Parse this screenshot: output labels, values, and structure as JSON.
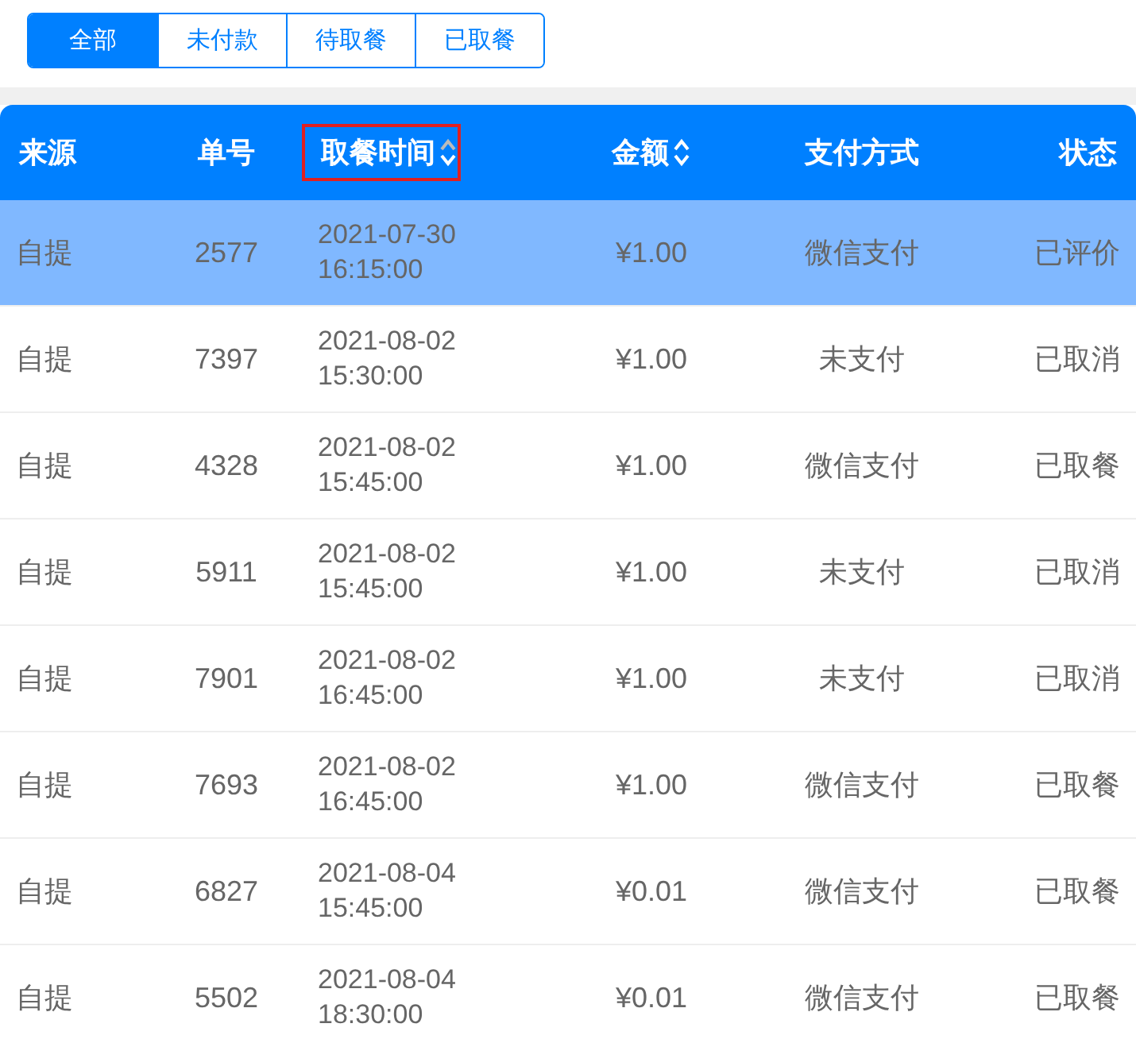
{
  "filter_tabs": [
    {
      "label": "全部",
      "selected": true
    },
    {
      "label": "未付款",
      "selected": false
    },
    {
      "label": "待取餐",
      "selected": false
    },
    {
      "label": "已取餐",
      "selected": false
    }
  ],
  "table": {
    "columns": [
      {
        "label": "来源",
        "highlighted": false
      },
      {
        "label": "单号",
        "highlighted": false
      },
      {
        "label": "取餐时间",
        "sorted_descending": true,
        "highlighted": true
      },
      {
        "label": "金额",
        "sorted_descending": false,
        "highlighted": false
      },
      {
        "label": "支付方式",
        "highlighted": false
      },
      {
        "label": "状态",
        "highlighted": false
      }
    ],
    "rows": [
      {
        "selected": true,
        "cells": [
          "自提",
          "2577",
          "2021-07-30 16:15:00",
          "¥1.00",
          "微信支付",
          "已评价"
        ]
      },
      {
        "selected": false,
        "cells": [
          "自提",
          "7397",
          "2021-08-02 15:30:00",
          "¥1.00",
          "未支付",
          "已取消"
        ]
      },
      {
        "selected": false,
        "cells": [
          "自提",
          "4328",
          "2021-08-02 15:45:00",
          "¥1.00",
          "微信支付",
          "已取餐"
        ]
      },
      {
        "selected": false,
        "cells": [
          "自提",
          "5911",
          "2021-08-02 15:45:00",
          "¥1.00",
          "未支付",
          "已取消"
        ]
      },
      {
        "selected": false,
        "cells": [
          "自提",
          "7901",
          "2021-08-02 16:45:00",
          "¥1.00",
          "未支付",
          "已取消"
        ]
      },
      {
        "selected": false,
        "cells": [
          "自提",
          "7693",
          "2021-08-02 16:45:00",
          "¥1.00",
          "微信支付",
          "已取餐"
        ]
      },
      {
        "selected": false,
        "cells": [
          "自提",
          "6827",
          "2021-08-04 15:45:00",
          "¥0.01",
          "微信支付",
          "已取餐"
        ]
      },
      {
        "selected": false,
        "cells": [
          "自提",
          "5502",
          "2021-08-04 18:30:00",
          "¥0.01",
          "微信支付",
          "已取餐"
        ]
      }
    ]
  }
}
